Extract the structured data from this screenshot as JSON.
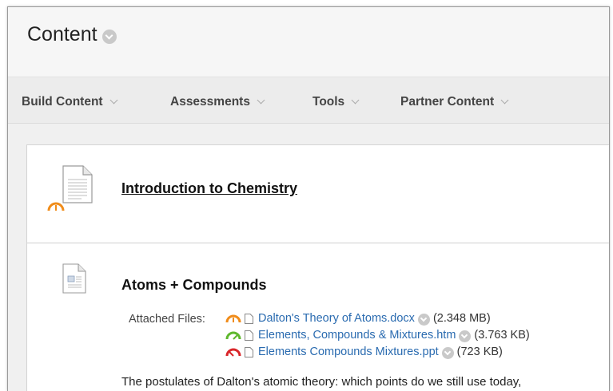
{
  "page": {
    "title": "Content"
  },
  "menu": {
    "items": [
      {
        "label": "Build Content"
      },
      {
        "label": "Assessments"
      },
      {
        "label": "Tools"
      },
      {
        "label": "Partner Content"
      }
    ]
  },
  "items": [
    {
      "title": "Introduction to Chemistry",
      "status_gauge": "orange-gauge-icon"
    },
    {
      "title": "Atoms + Compounds",
      "attached_label": "Attached Files:",
      "files": [
        {
          "name": "Dalton's Theory of Atoms.docx",
          "size": "(2.348 MB)",
          "gauge_color": "#f08c1a"
        },
        {
          "name": "Elements, Compounds & Mixtures.htm",
          "size": "(3.763 KB)",
          "gauge_color": "#5fb82e"
        },
        {
          "name": "Elements Compounds Mixtures.ppt",
          "size": "(723 KB)",
          "gauge_color": "#d9262a"
        }
      ],
      "description": "The postulates of Dalton's atomic theory: which points do we still use today,"
    }
  ],
  "colors": {
    "link": "#2a6bb0",
    "gauge_orange": "#f08c1a",
    "gauge_green": "#5fb82e",
    "gauge_red": "#d9262a"
  }
}
